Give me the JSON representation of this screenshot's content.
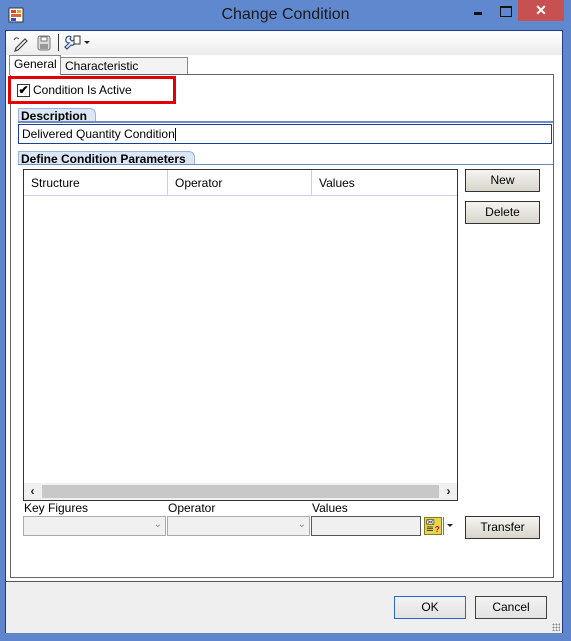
{
  "window": {
    "title": "Change Condition",
    "close_glyph": "✕"
  },
  "toolbar": {
    "icons": [
      "edit-icon",
      "save-icon",
      "tools-icon"
    ]
  },
  "tabs": [
    {
      "label": "General",
      "active": true
    },
    {
      "label": "Characteristic Assignment",
      "active": false
    }
  ],
  "general": {
    "condition_active": {
      "label": "Condition Is Active",
      "checked": true,
      "check_glyph": "✔"
    },
    "description": {
      "group_label": "Description",
      "value": "Delivered Quantity Condition"
    },
    "parameters": {
      "group_label": "Define Condition Parameters",
      "columns": [
        "Structure",
        "Operator",
        "Values"
      ],
      "rows": [],
      "scroll_left": "‹",
      "scroll_right": "›",
      "new_label": "New",
      "delete_label": "Delete"
    },
    "entry": {
      "key_figures_label": "Key Figures",
      "key_figures_value": "",
      "operator_label": "Operator",
      "operator_value": "",
      "values_label": "Values",
      "values_value": "",
      "chevron": "⌄",
      "transfer_label": "Transfer"
    }
  },
  "footer": {
    "ok_label": "OK",
    "cancel_label": "Cancel"
  }
}
